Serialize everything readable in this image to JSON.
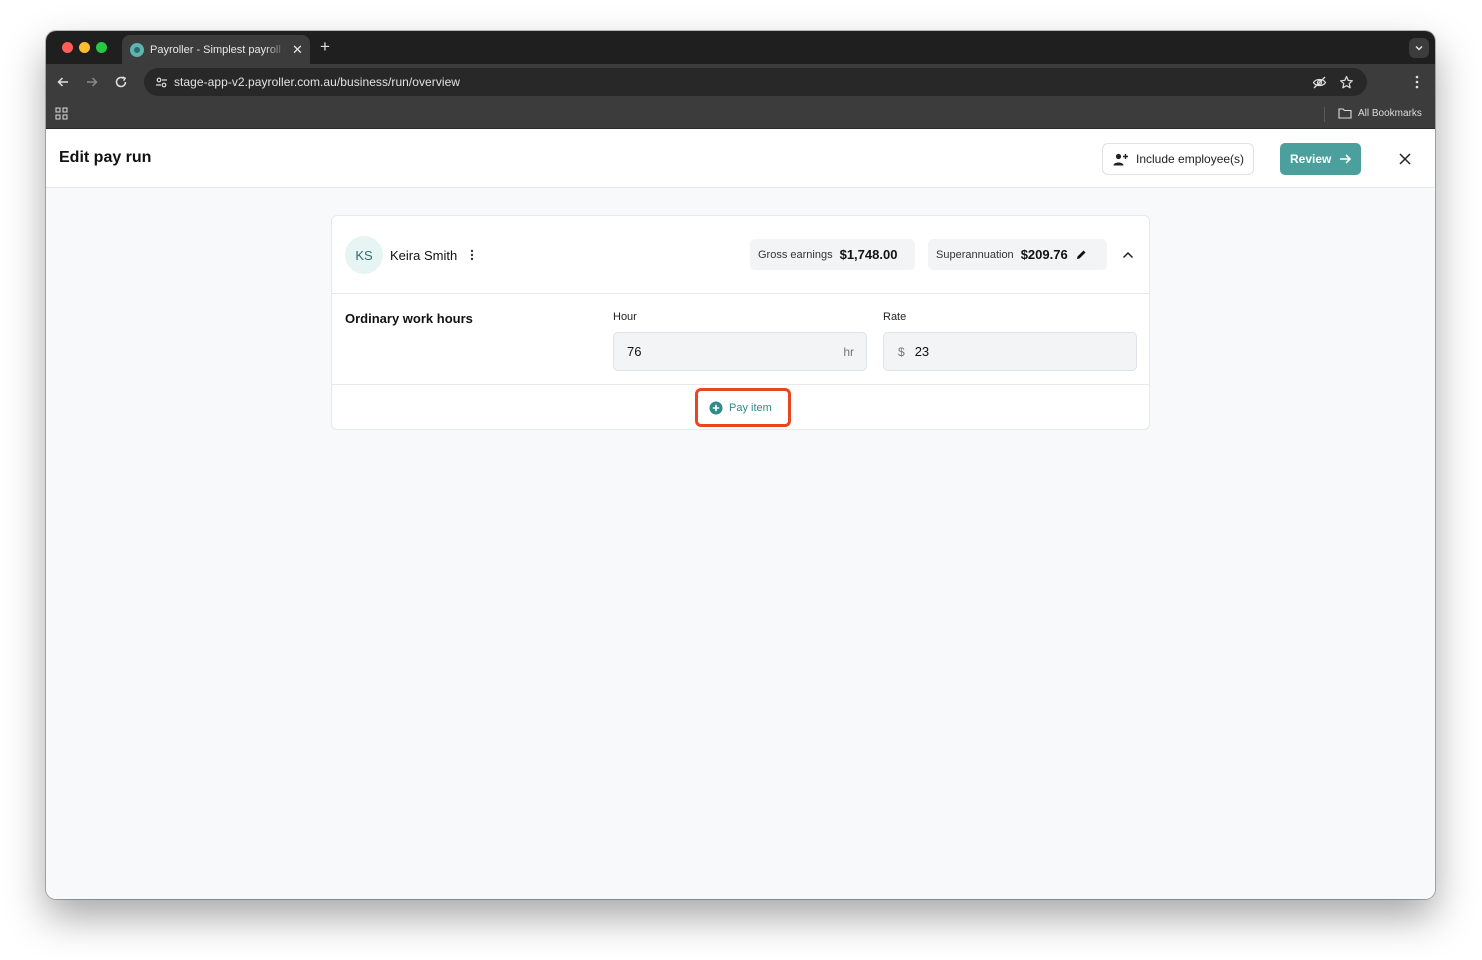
{
  "browser": {
    "tab_title": "Payroller - Simplest payroll software",
    "url": "stage-app-v2.payroller.com.au/business/run/overview",
    "bookmarks_label": "All Bookmarks"
  },
  "header": {
    "title": "Edit pay run",
    "include_label": "Include employee(s)",
    "review_label": "Review"
  },
  "employee": {
    "initials": "KS",
    "name": "Keira Smith",
    "gross_label": "Gross earnings",
    "gross_value": "$1,748.00",
    "super_label": "Superannuation",
    "super_value": "$209.76"
  },
  "ordinary": {
    "label": "Ordinary work hours",
    "hour_label": "Hour",
    "hour_value": "76",
    "hour_unit": "hr",
    "rate_label": "Rate",
    "rate_prefix": "$",
    "rate_value": "23"
  },
  "actions": {
    "pay_item_label": "Pay item"
  },
  "colors": {
    "accent": "#4b9f9c",
    "highlight": "#e9461f"
  }
}
